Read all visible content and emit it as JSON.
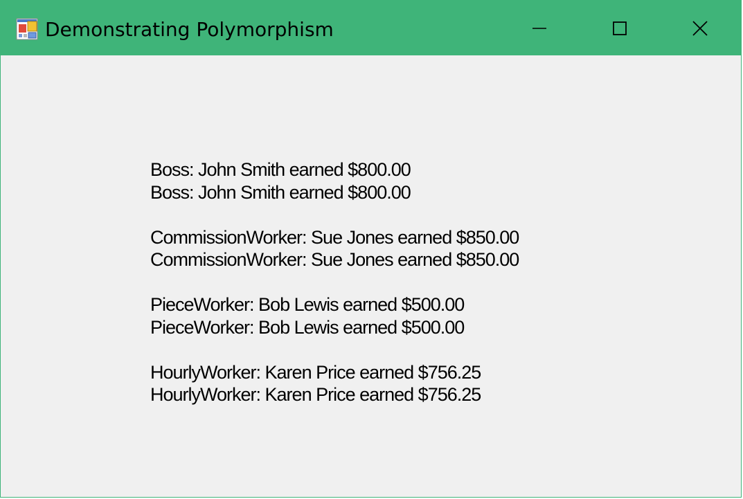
{
  "window": {
    "title": "Demonstrating Polymorphism",
    "accent_color": "#3fb479",
    "icon": "winforms-app-icon"
  },
  "caption_buttons": {
    "minimize": "minimize-icon",
    "maximize": "maximize-icon",
    "close": "close-icon"
  },
  "output": {
    "groups": [
      {
        "lines": [
          "Boss: John Smith earned $800.00",
          "Boss: John Smith earned $800.00"
        ]
      },
      {
        "lines": [
          "CommissionWorker: Sue Jones earned $850.00",
          "CommissionWorker: Sue Jones earned $850.00"
        ]
      },
      {
        "lines": [
          "PieceWorker: Bob Lewis earned $500.00",
          "PieceWorker: Bob Lewis earned $500.00"
        ]
      },
      {
        "lines": [
          "HourlyWorker: Karen Price earned $756.25",
          "HourlyWorker: Karen Price earned $756.25"
        ]
      }
    ]
  }
}
